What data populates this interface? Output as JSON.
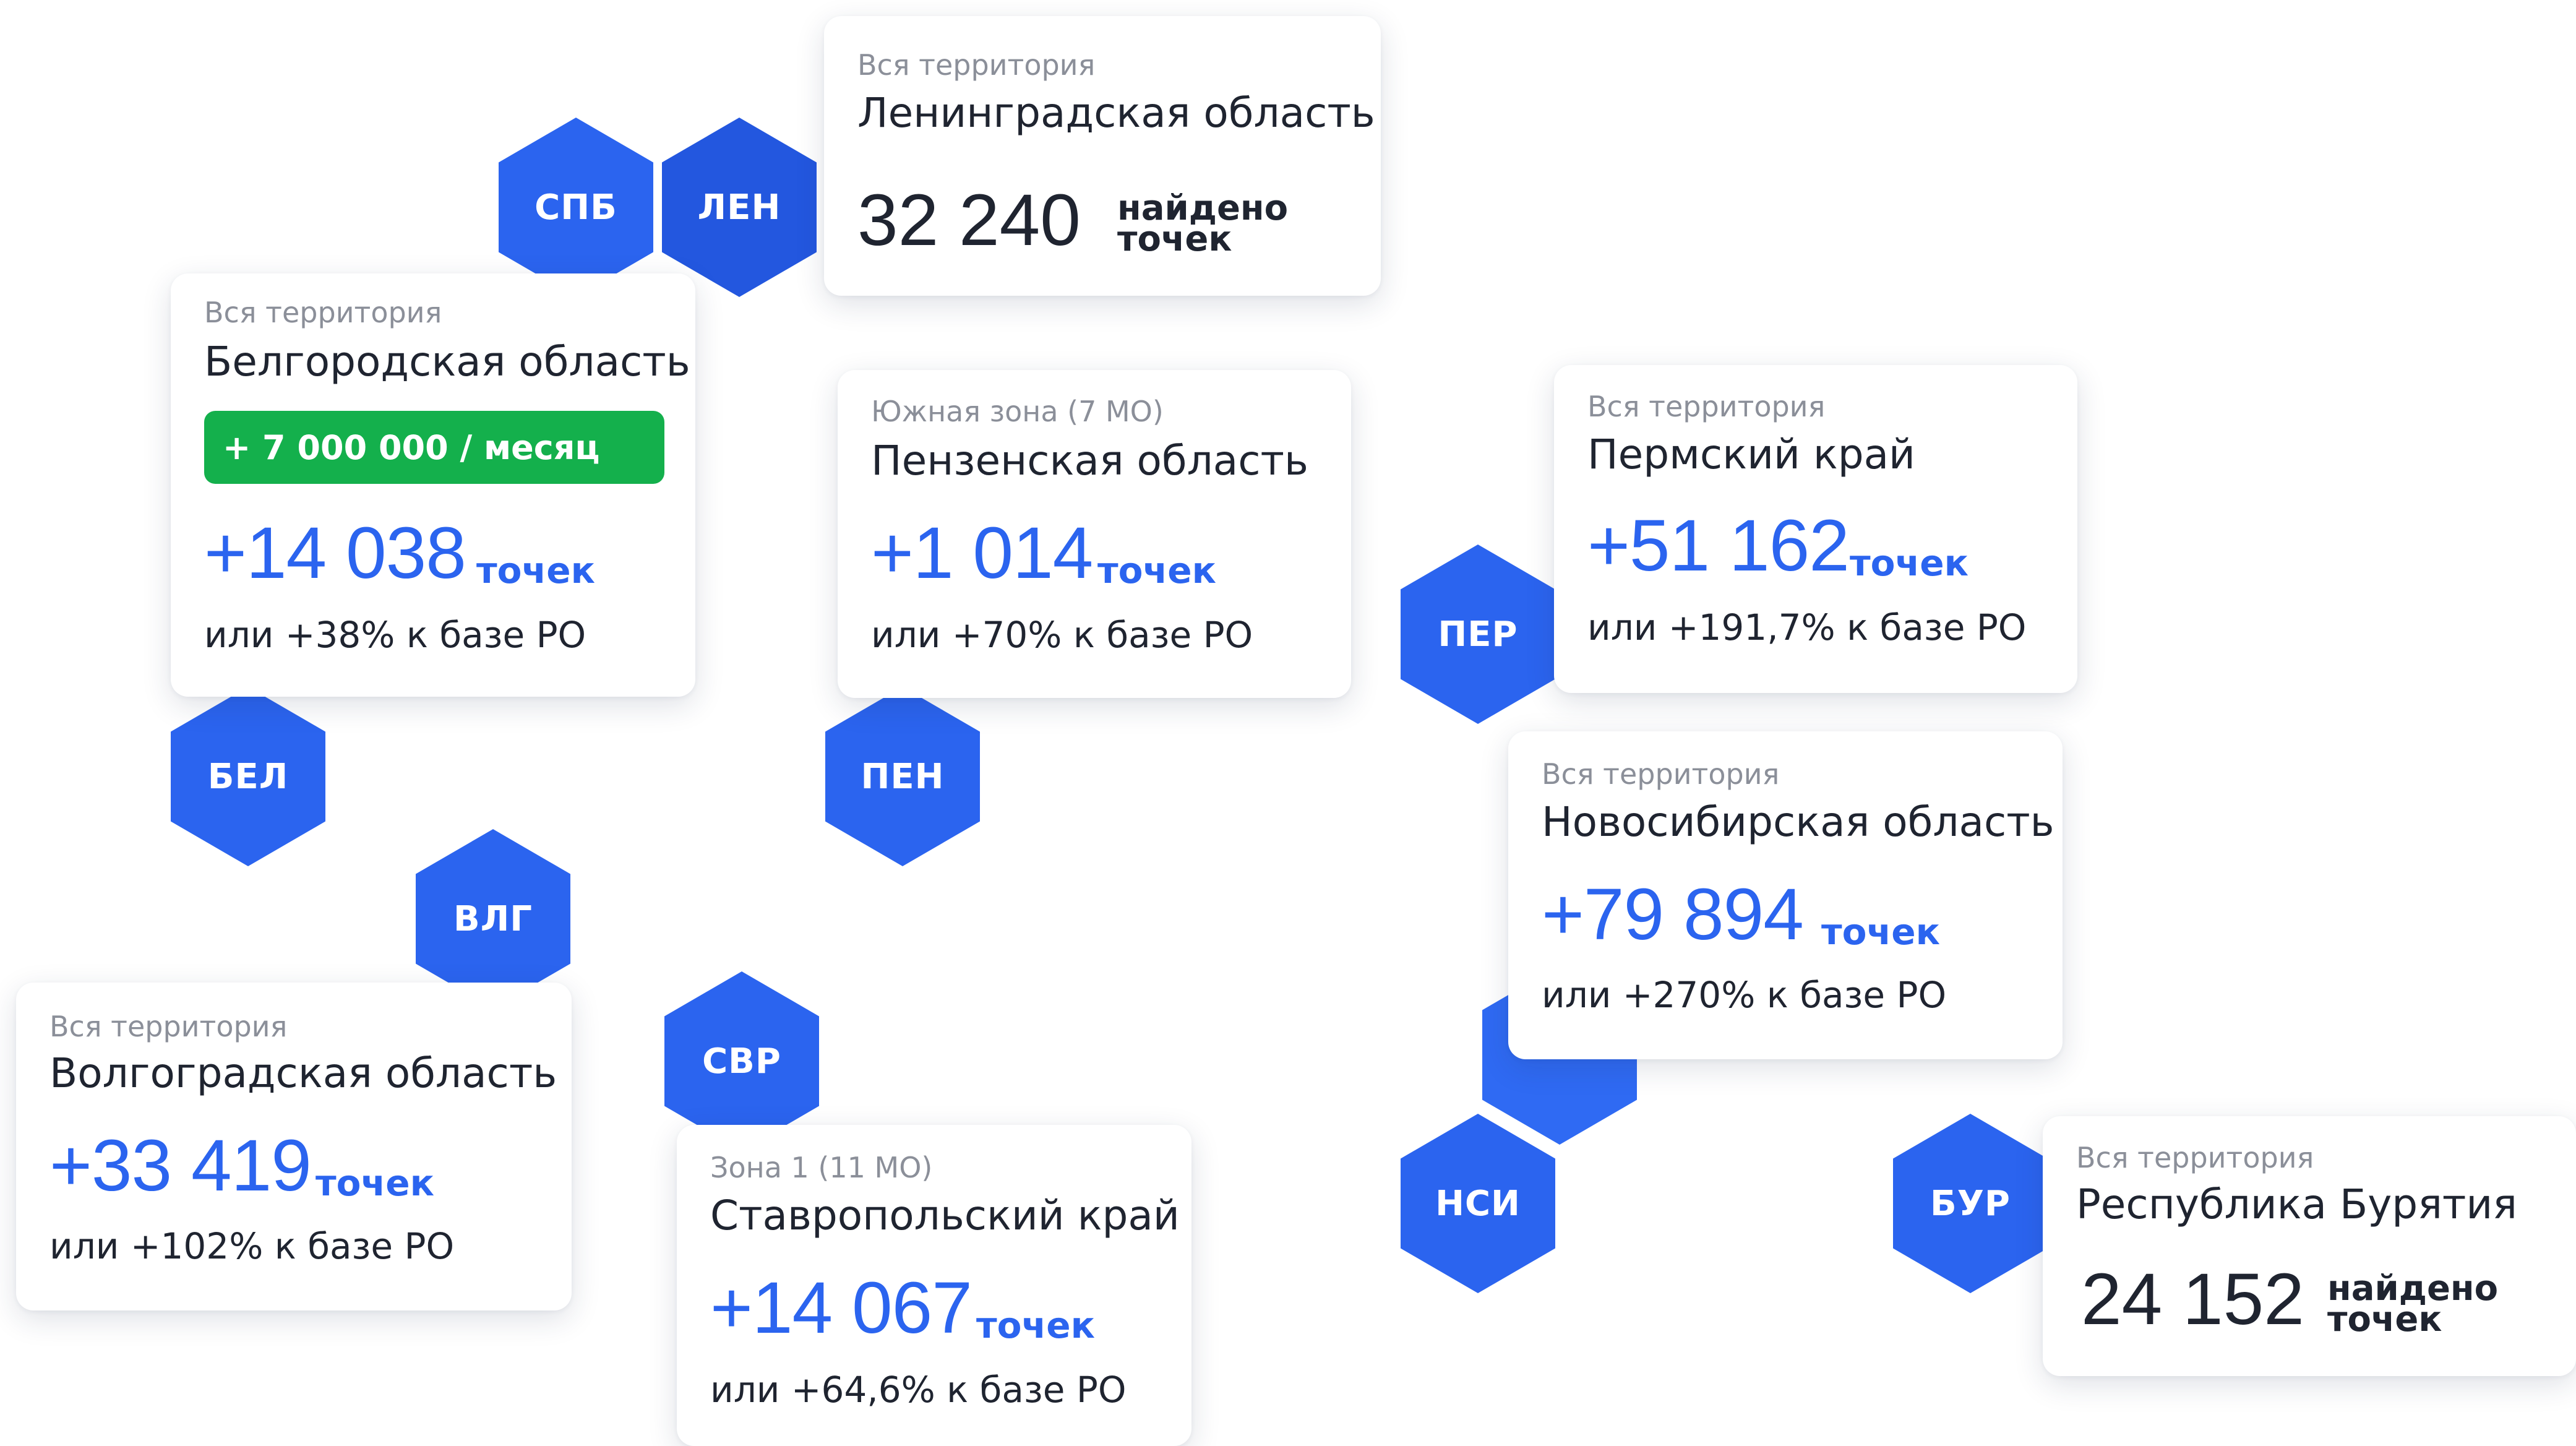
{
  "colors": {
    "accent": "#2b64ef",
    "badge_green": "#14b04c",
    "text_dark": "#1f2430",
    "text_muted": "#8b8f99"
  },
  "hexes": {
    "spb": "СПБ",
    "len": "ЛЕН",
    "bel": "БЕЛ",
    "pen": "ПЕН",
    "per": "ПЕР",
    "vlg": "ВЛГ",
    "svr": "СВР",
    "nsi": "НСИ",
    "bur": "БУР"
  },
  "cards": {
    "leningrad": {
      "subtitle": "Вся территория",
      "title": "Ленинградская область",
      "count": "32 240",
      "count_label_1": "найдено",
      "count_label_2": "точек"
    },
    "belgorod": {
      "subtitle": "Вся территория",
      "title": "Белгородская область",
      "badge": "+ 7 000 000 / месяц",
      "value": "+14 038",
      "unit": "точек",
      "note": "или +38% к базе РО"
    },
    "penza": {
      "subtitle": "Южная зона (7 МО)",
      "title": "Пензенская область",
      "value": "+1 014",
      "unit": "точек",
      "note": "или +70% к базе РО"
    },
    "perm": {
      "subtitle": "Вся территория",
      "title": "Пермский край",
      "value": "+51 162",
      "unit": "точек",
      "note": "или +191,7% к базе РО"
    },
    "novosibirsk": {
      "subtitle": "Вся территория",
      "title": "Новосибирская область",
      "value": "+79 894",
      "unit": "точек",
      "note": "или +270% к базе РО"
    },
    "volgograd": {
      "subtitle": "Вся территория",
      "title": "Волгоградская область",
      "value": "+33 419",
      "unit": "точек",
      "note": "или +102% к базе РО"
    },
    "stavropol": {
      "subtitle": "Зона 1 (11 МО)",
      "title": "Ставропольский край",
      "value": "+14 067",
      "unit": "точек",
      "note": "или +64,6% к базе РО"
    },
    "buryatia": {
      "subtitle": "Вся территория",
      "title": "Республика Бурятия",
      "count": "24 152",
      "count_label_1": "найдено",
      "count_label_2": "точек"
    }
  }
}
